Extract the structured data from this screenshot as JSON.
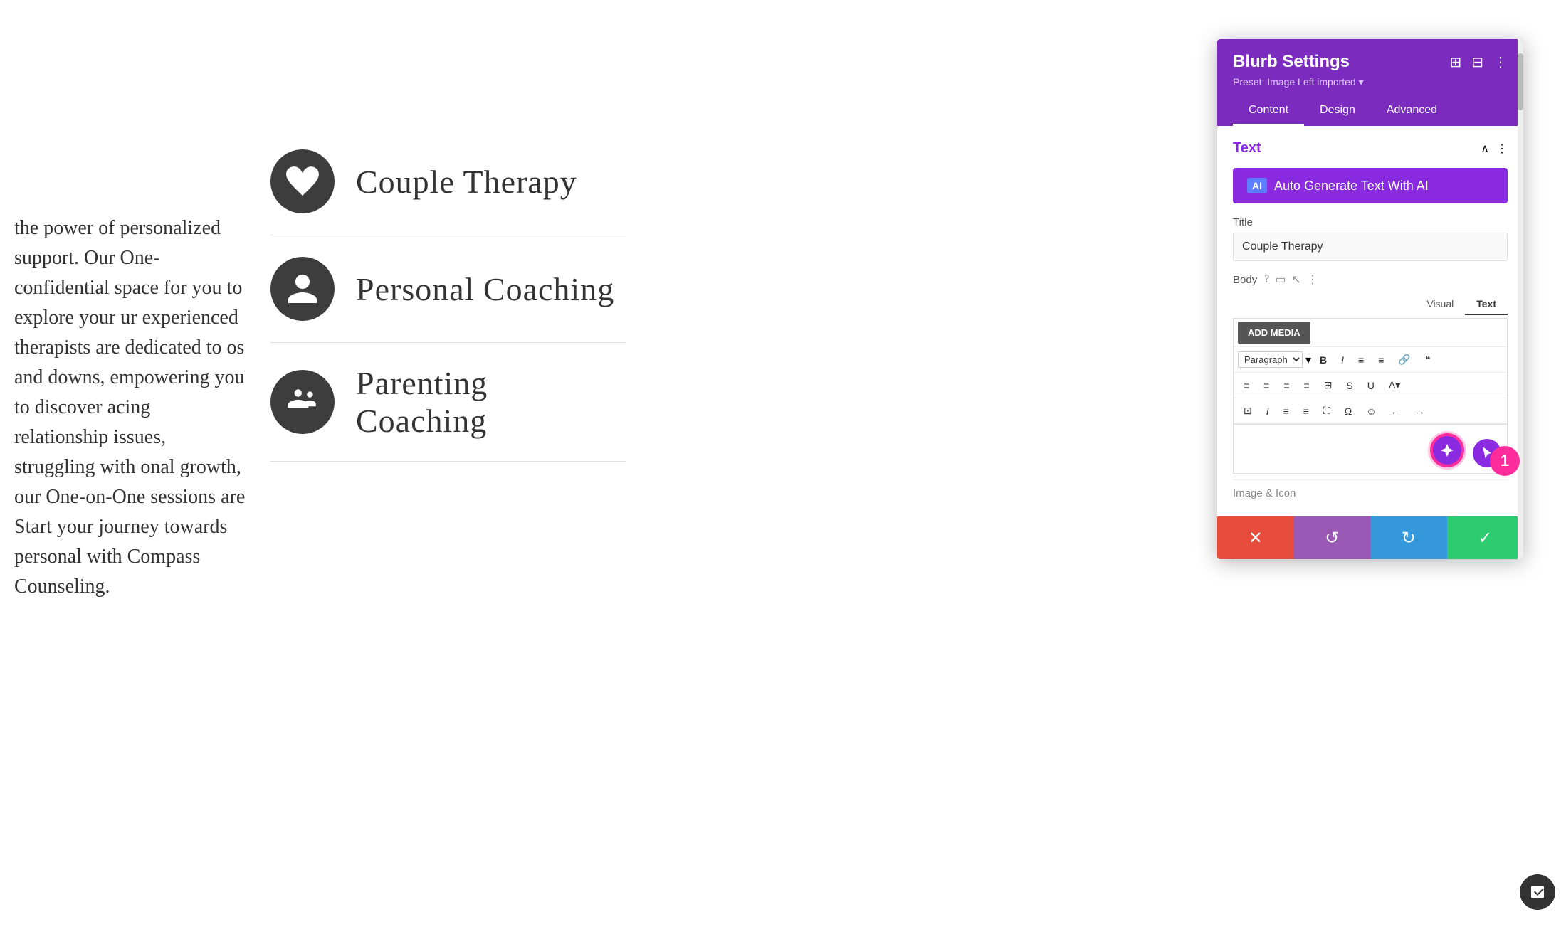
{
  "page": {
    "background_color": "#f0f0f0"
  },
  "left_text": {
    "paragraph": "the power of personalized support. Our One-confidential space for you to explore your ur experienced therapists are dedicated to os and downs, empowering you to discover acing relationship issues, struggling with onal growth, our One-on-One sessions are Start your journey towards personal with Compass Counseling."
  },
  "services": [
    {
      "id": "couple-therapy",
      "label": "Couple Therapy",
      "icon": "heart"
    },
    {
      "id": "personal-coaching",
      "label": "Personal Coaching",
      "icon": "person"
    },
    {
      "id": "parenting-coaching",
      "label": "Parenting Coaching",
      "icon": "family"
    }
  ],
  "panel": {
    "title": "Blurb Settings",
    "preset": "Preset: Image Left imported",
    "tabs": [
      "Content",
      "Design",
      "Advanced"
    ],
    "active_tab": "Content",
    "section_title": "Text",
    "ai_button_label": "Auto Generate Text With AI",
    "ai_badge": "AI",
    "title_label": "Title",
    "title_value": "Couple Therapy",
    "body_label": "Body",
    "editor_tabs": [
      "Visual",
      "Text"
    ],
    "active_editor_tab": "Text",
    "add_media_label": "ADD MEDIA",
    "paragraph_label": "Paragraph",
    "toolbar_buttons": [
      "B",
      "I",
      "≡",
      "≡",
      "🔗",
      "❝",
      "≡",
      "≡",
      "≡",
      "≡",
      "⊞",
      "S",
      "U",
      "A",
      "⊡",
      "I",
      "≡",
      "≡",
      "⛶",
      "Ω",
      "☺",
      "←",
      "→"
    ],
    "image_icon_label": "Image & Icon",
    "footer_buttons": {
      "cancel": "✕",
      "undo": "↺",
      "redo": "↻",
      "confirm": "✓"
    },
    "badge_number": "1"
  }
}
